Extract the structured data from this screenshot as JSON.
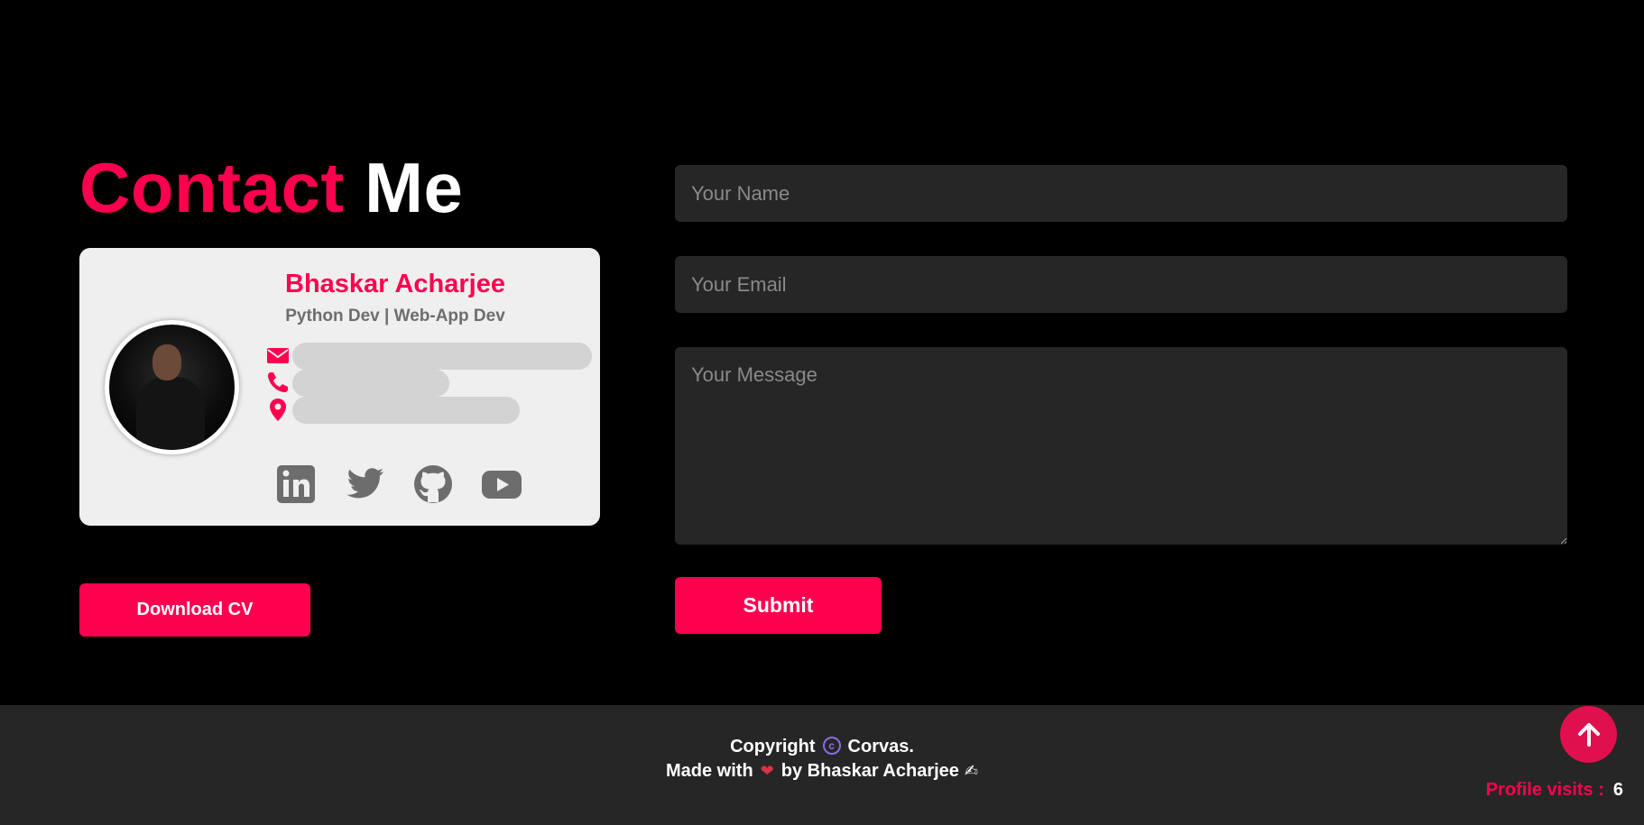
{
  "heading": {
    "accent": "Contact",
    "rest": "Me"
  },
  "card": {
    "name": "Bhaskar Acharjee",
    "role": "Python Dev | Web-App Dev",
    "avatar_icon": "profile-photo",
    "rows": [
      {
        "icon": "envelope-icon",
        "value_redacted": true
      },
      {
        "icon": "phone-icon",
        "value_redacted": true
      },
      {
        "icon": "location-pin-icon",
        "value_redacted": true
      }
    ],
    "socials": [
      "linkedin-icon",
      "twitter-icon",
      "github-icon",
      "youtube-icon"
    ]
  },
  "buttons": {
    "download_cv": "Download CV",
    "submit": "Submit"
  },
  "form": {
    "name_placeholder": "Your Name",
    "email_placeholder": "Your Email",
    "message_placeholder": "Your Message"
  },
  "footer": {
    "copyright_prefix": "Copyright",
    "copyright_owner": "Corvas.",
    "made_with": "Made with",
    "by": "by Bhaskar Acharjee",
    "visits_label": "Profile visits :",
    "visits_count": "6"
  },
  "colors": {
    "accent": "#ff004f",
    "background": "#000000",
    "card": "#efefef",
    "input": "#262626",
    "icon_gray": "#6d6d6d"
  }
}
